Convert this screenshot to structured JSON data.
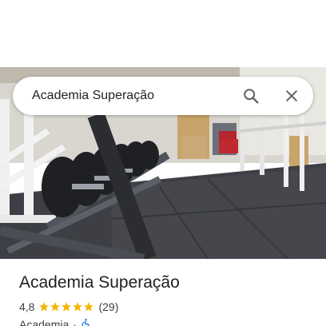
{
  "search": {
    "query": "Academia Superação"
  },
  "place": {
    "name": "Academia Superação",
    "rating": "4,8",
    "stars": 5,
    "review_count": "(29)",
    "category": "Academia",
    "separator": "·",
    "accessibility_icon": "wheelchair-icon"
  },
  "icons": {
    "search": "search-icon",
    "close": "close-icon"
  },
  "colors": {
    "star": "#f4b400",
    "accessibility": "#1a73e8",
    "text_primary": "#202124",
    "text_secondary": "#3c4043"
  }
}
